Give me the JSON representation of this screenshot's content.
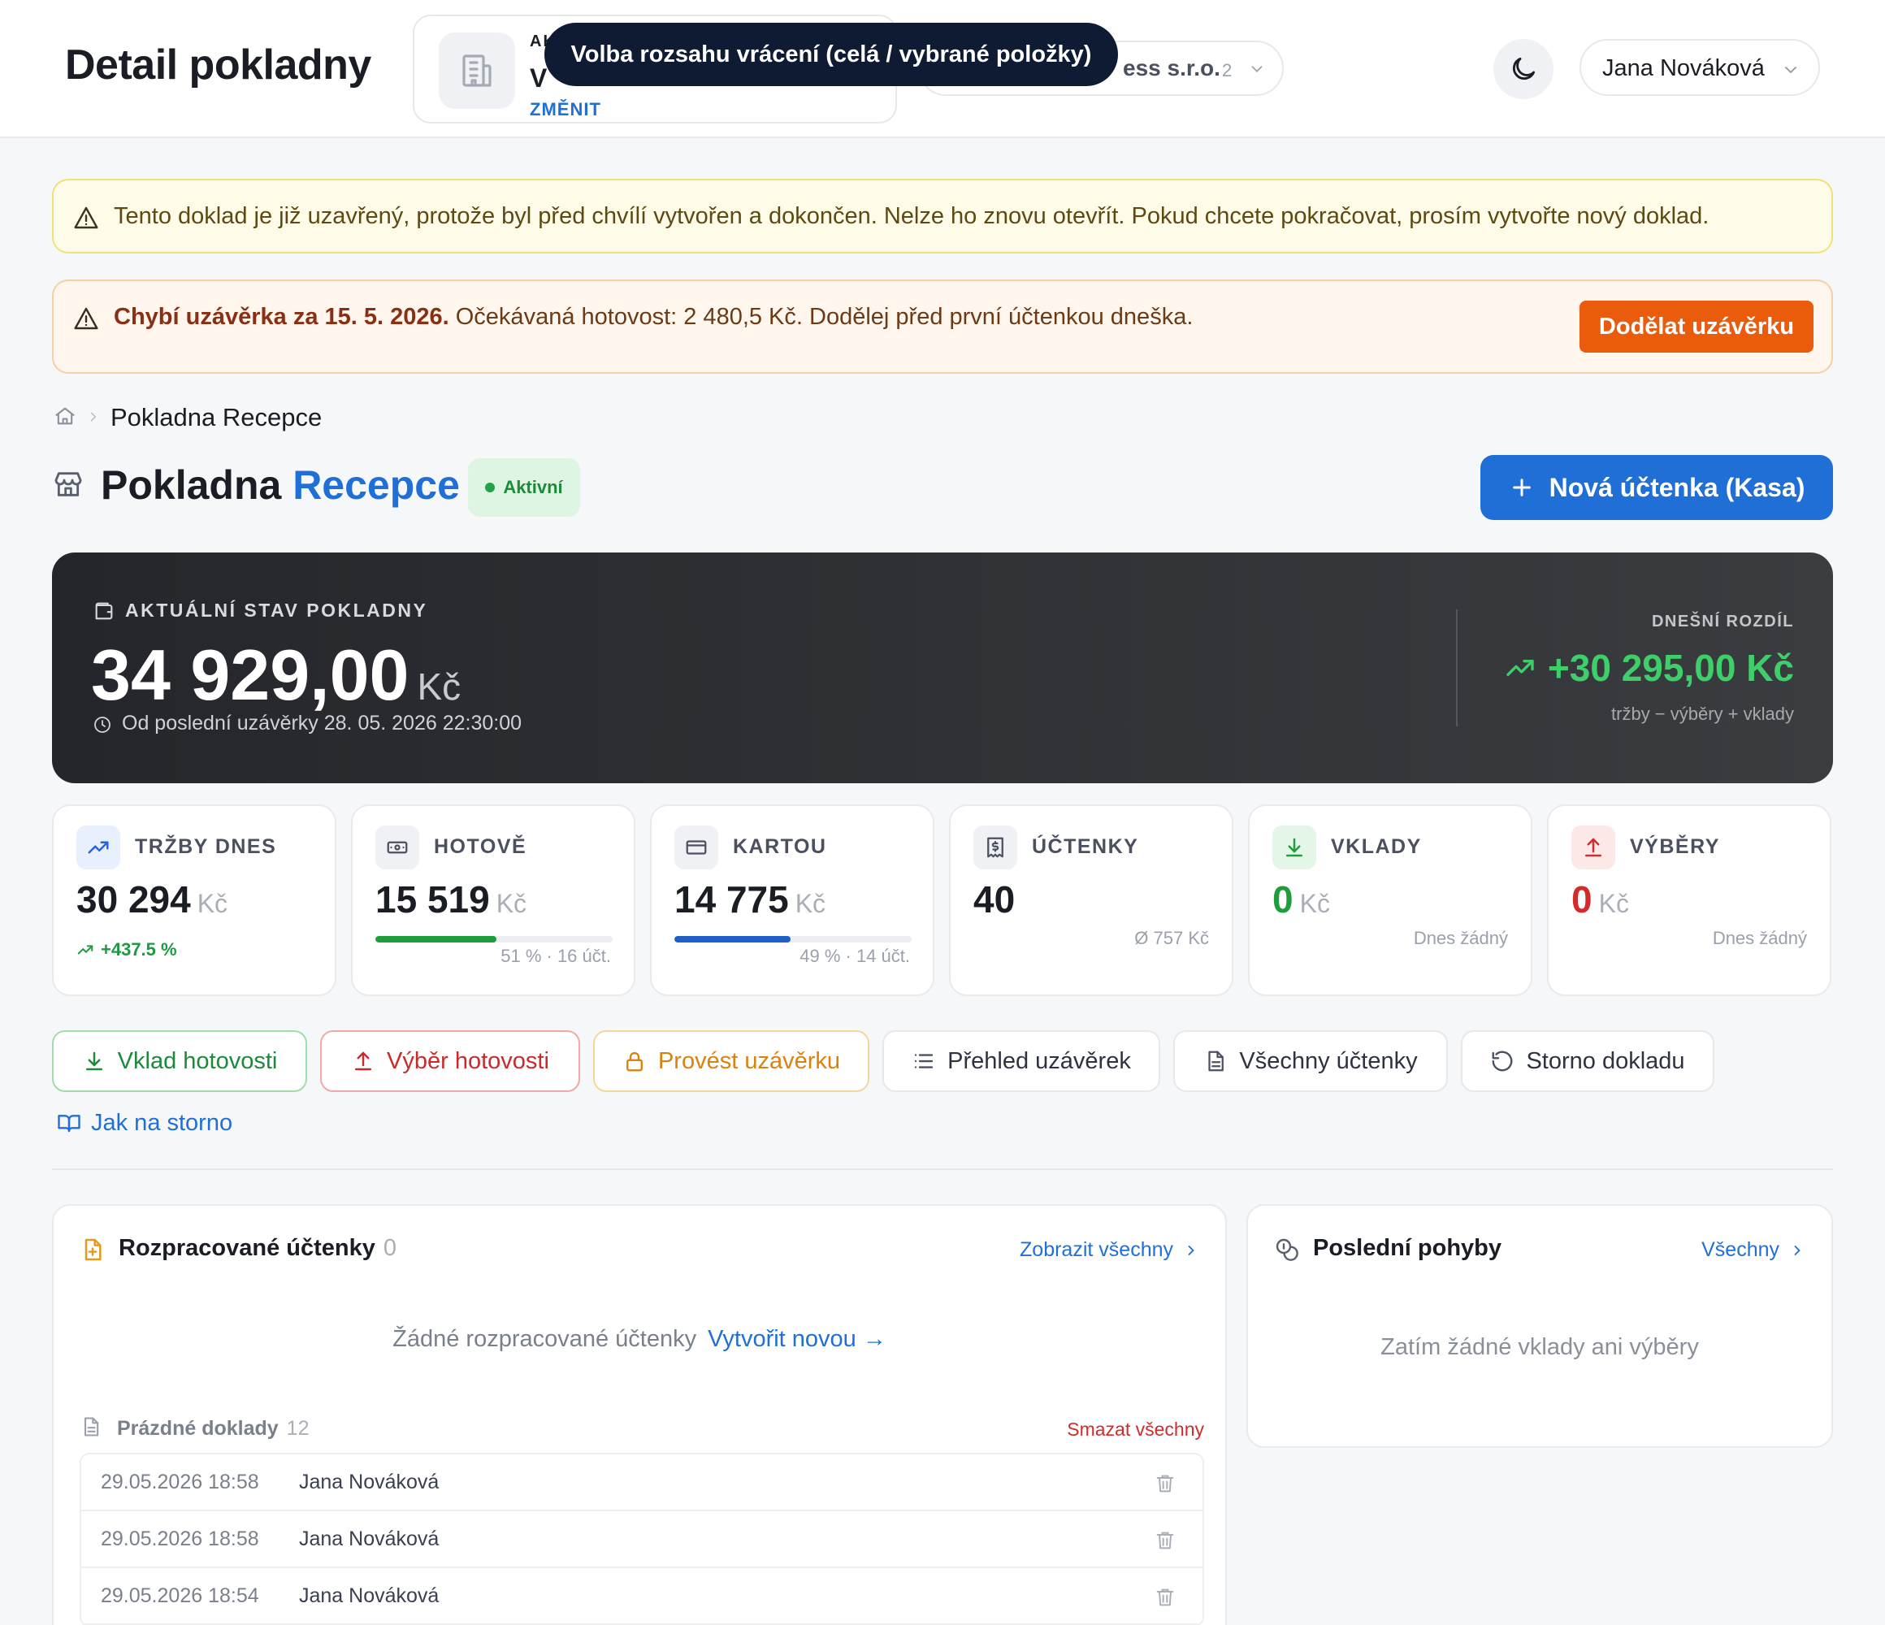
{
  "header": {
    "title": "Detail pokladny",
    "company_card": {
      "label": "AK",
      "name": "V",
      "change_label": "ZMĚNIT"
    },
    "company_select": {
      "text": "ess s.r.o.",
      "count": "2"
    },
    "tooltip": "Volba rozsahu vrácení (celá / vybrané položky)",
    "user_name": "Jana Nováková",
    "icons": {
      "company": "building-icon",
      "theme": "moon-icon",
      "chevron": "chevron-down-icon"
    }
  },
  "alerts": {
    "closed": "Tento doklad je již uzavřený, protože byl před chvílí vytvořen a dokončen. Nelze ho znovu otevřít. Pokud chcete pokračovat, prosím vytvořte nový doklad.",
    "missing_bold": "Chybí uzávěrka za 15. 5. 2026.",
    "missing_text": "Očekávaná hotovost: 2 480,5 Kč. Dodělej před první účtenkou dneška.",
    "missing_button": "Dodělat uzávěrku"
  },
  "breadcrumb": {
    "current": "Pokladna Recepce"
  },
  "register": {
    "title_main": "Pokladna",
    "title_accent": "Recepce",
    "status": "Aktivní",
    "new_receipt_button": "Nová účtenka (Kasa)"
  },
  "balance": {
    "label": "AKTUÁLNÍ STAV POKLADNY",
    "amount": "34 929,00",
    "currency": "Kč",
    "since": "Od poslední uzávěrky 28. 05. 2026 22:30:00",
    "diff_label": "DNEŠNÍ ROZDÍL",
    "diff_value": "+30 295,00 Kč",
    "diff_note": "tržby − výběry + vklady"
  },
  "stats": [
    {
      "label": "TRŽBY DNES",
      "value": "30 294",
      "currency": "Kč",
      "trend": "+437.5 %",
      "icon": "trending-up-icon",
      "color": "#2563eb"
    },
    {
      "label": "HOTOVĚ",
      "value": "15 519",
      "currency": "Kč",
      "share": 0.51,
      "note": "51 % · 16 účt.",
      "icon": "banknote-icon",
      "color": "#1f9d3a"
    },
    {
      "label": "KARTOU",
      "value": "14 775",
      "currency": "Kč",
      "share": 0.49,
      "note": "49 % · 14 účt.",
      "icon": "credit-card-icon",
      "color": "#1f5fc6"
    },
    {
      "label": "ÚČTENKY",
      "value": "40",
      "note": "Ø 757 Kč",
      "icon": "receipt-icon"
    },
    {
      "label": "VKLADY",
      "value": "0",
      "currency": "Kč",
      "note": "Dnes žádný",
      "icon": "arrow-down-icon",
      "color": "#1f9d3a"
    },
    {
      "label": "VÝBĚRY",
      "value": "0",
      "currency": "Kč",
      "note": "Dnes žádný",
      "icon": "arrow-up-icon",
      "color": "#d12c2c"
    }
  ],
  "actions": {
    "deposit": "Vklad hotovosti",
    "withdraw": "Výběr hotovosti",
    "closing": "Provést uzávěrku",
    "closings_overview": "Přehled uzávěrek",
    "all_receipts": "Všechny účtenky",
    "storno": "Storno dokladu",
    "howto": "Jak na storno"
  },
  "drafts": {
    "title": "Rozpracované účtenky",
    "count": "0",
    "show_all": "Zobrazit všechny",
    "empty_text": "Žádné rozpracované účtenky",
    "create_new": "Vytvořit novou →",
    "empty_docs_label": "Prázdné doklady",
    "empty_docs_count": "12",
    "delete_all": "Smazat všechny",
    "rows": [
      {
        "date": "29.05.2026 18:58",
        "user": "Jana Nováková"
      },
      {
        "date": "29.05.2026 18:58",
        "user": "Jana Nováková"
      },
      {
        "date": "29.05.2026 18:54",
        "user": "Jana Nováková"
      }
    ]
  },
  "moves": {
    "title": "Poslední pohyby",
    "all_link": "Všechny",
    "empty_text": "Zatím žádné vklady ani výběry"
  },
  "colors": {
    "accent": "#1f6fd6",
    "warning": "#ea5b0c",
    "success": "#1f9d3a",
    "danger": "#d12c2c"
  }
}
